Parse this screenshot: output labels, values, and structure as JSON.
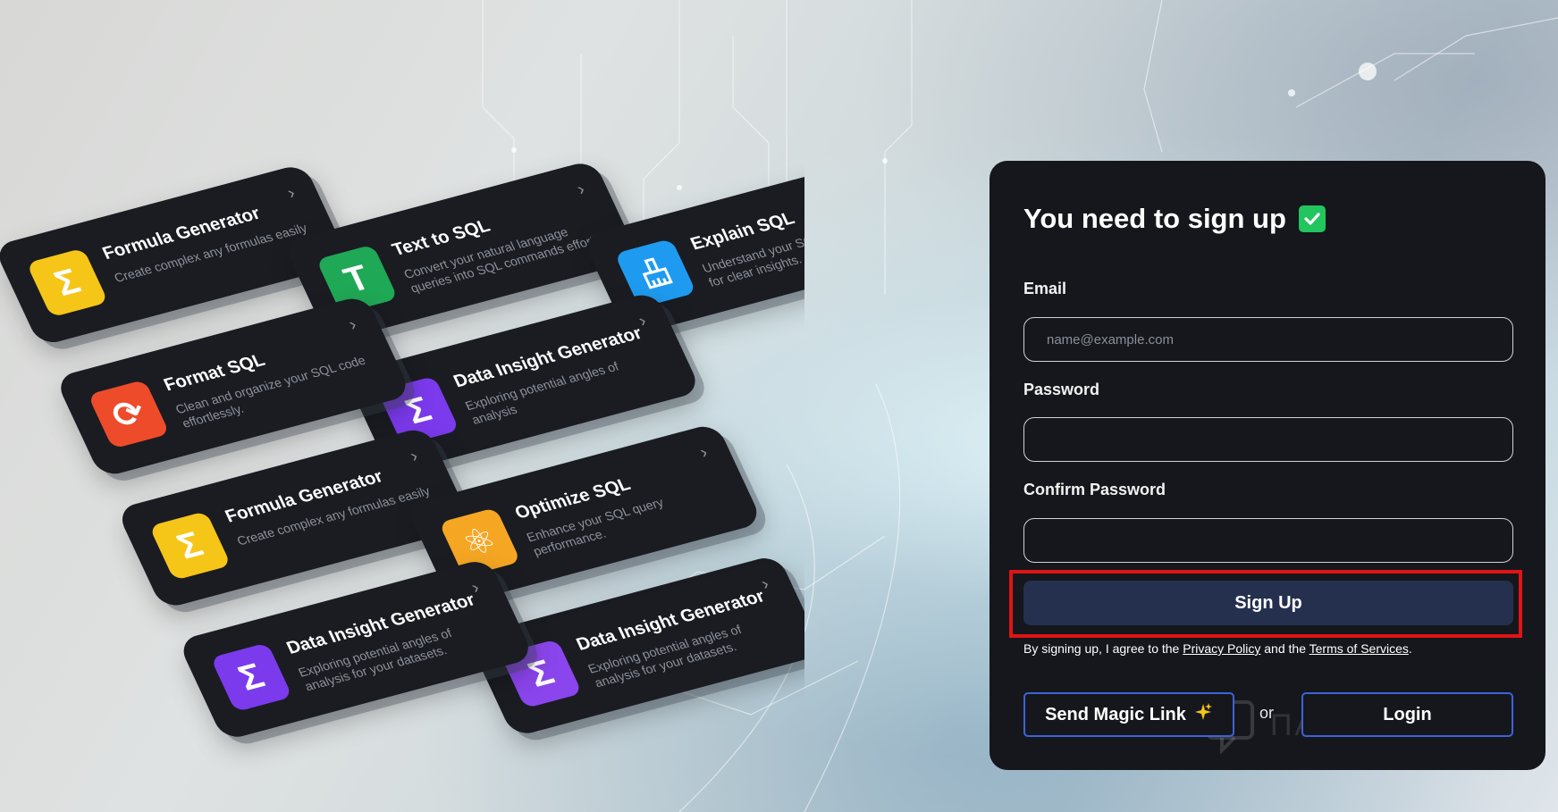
{
  "cards": [
    {
      "title": "Formula Generator",
      "description": "Create complex any formulas easily",
      "icon": "sigma-icon",
      "glyph": "Σ",
      "color": "#f5c518"
    },
    {
      "title": "Text to SQL",
      "description": "Convert your natural language queries into SQL commands effortl...",
      "icon": "text-t-icon",
      "glyph": "T",
      "color": "#1fa855"
    },
    {
      "title": "Explain SQL",
      "description": "Understand your SQL queries better for clear insights.",
      "icon": "brush-icon",
      "glyph": "",
      "color": "#1e9bf0"
    },
    {
      "title": "Data Insight Generator",
      "description": "Exploring potential angles of analysis",
      "icon": "sigma-icon",
      "glyph": "Σ",
      "color": "#7c3aed"
    },
    {
      "title": "Format SQL",
      "description": "Clean and organize your SQL code effortlessly.",
      "icon": "refresh-icon",
      "glyph": "⟳",
      "color": "#ee4b2b"
    },
    {
      "title": "Data Insight Generator",
      "description": "Exploring potential angles of analysis for your datasets.",
      "icon": "sigma-icon",
      "glyph": "Σ",
      "color": "#8b45ec"
    },
    {
      "title": "Formula Generator",
      "description": "Create complex any formulas easily",
      "icon": "sigma-icon",
      "glyph": "Σ",
      "color": "#f5c518"
    },
    {
      "title": "Optimize SQL",
      "description": "Enhance your SQL query performance.",
      "icon": "atom-icon",
      "glyph": "⚛",
      "color": "#f5a623"
    },
    {
      "title": "Data Insight Generator",
      "description": "Exploring potential angles of analysis for your datasets.",
      "icon": "sigma-icon",
      "glyph": "Σ",
      "color": "#7c3aed"
    }
  ],
  "signup": {
    "title": "You need to sign up",
    "email_label": "Email",
    "email_placeholder": "name@example.com",
    "email_value": "",
    "password_label": "Password",
    "password_value": "",
    "confirm_label": "Confirm Password",
    "confirm_value": "",
    "signup_button": "Sign Up",
    "terms_prefix": "By signing up, I agree to the ",
    "privacy_link": "Privacy Policy",
    "terms_middle": " and the ",
    "terms_link": "Terms of Services",
    "terms_suffix": ".",
    "magic_link_button": "Send Magic Link",
    "or_text": "or",
    "login_button": "Login",
    "accent_color": "#3d63d8",
    "highlight_color": "#e01414"
  },
  "watermark": {
    "text": "ПАРТНЕРКИН"
  }
}
